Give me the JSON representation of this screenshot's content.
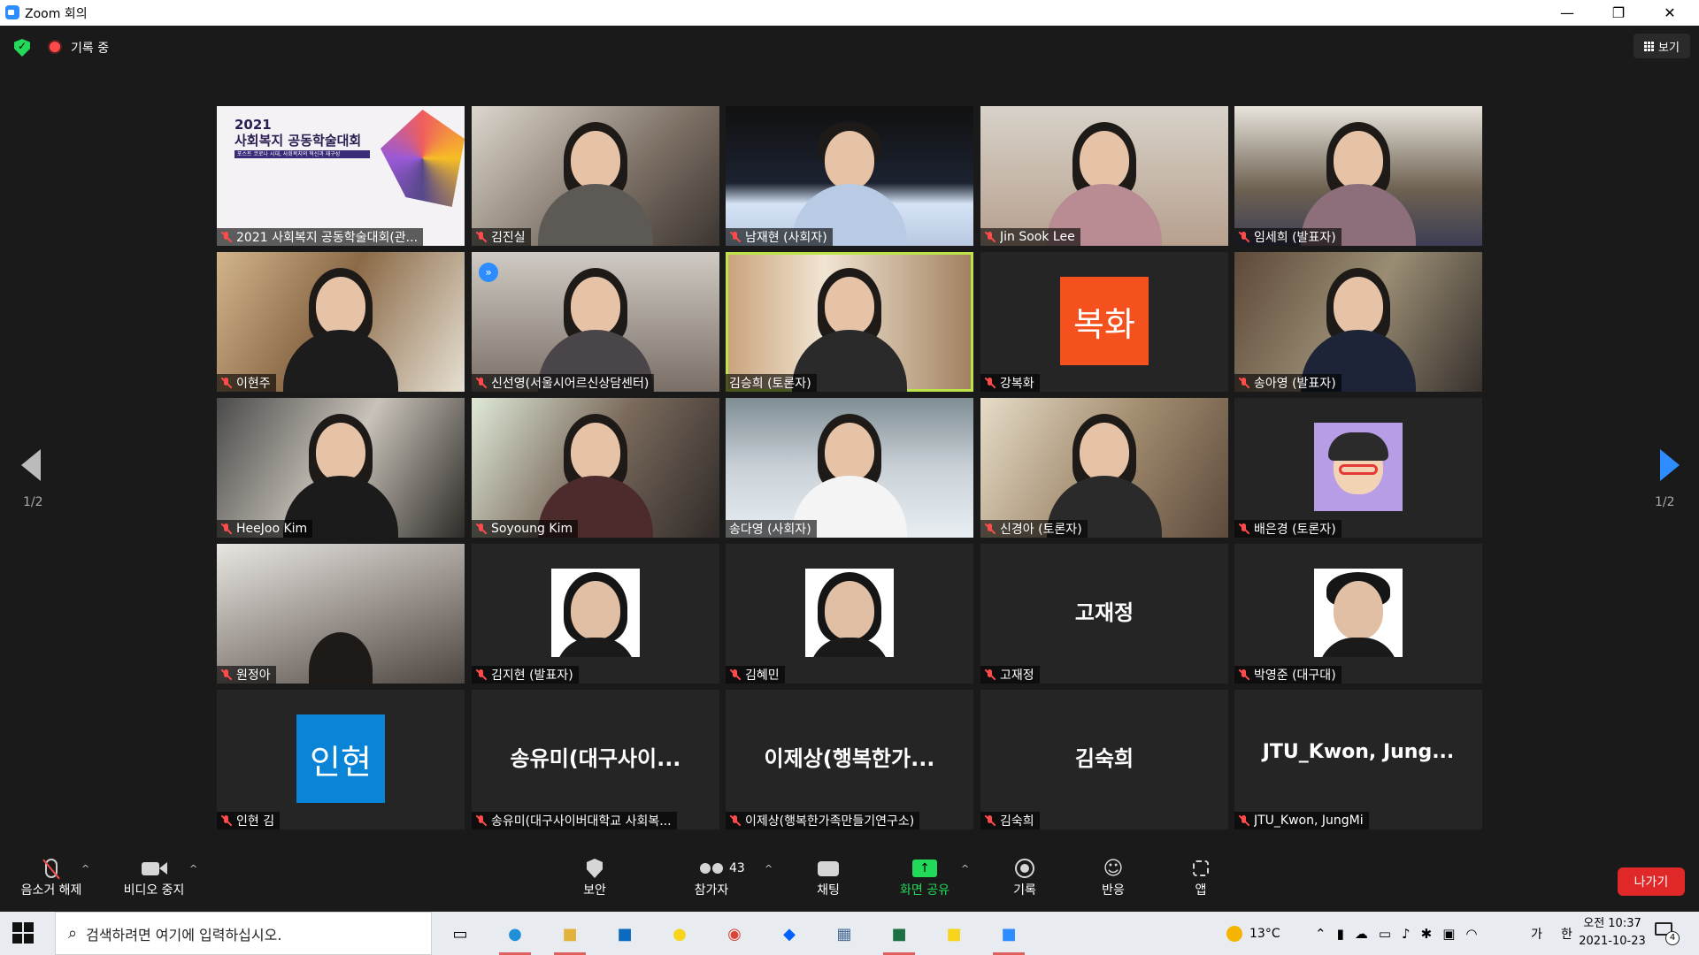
{
  "window": {
    "title": "Zoom 회의",
    "minimize": "—",
    "restore": "❐",
    "close": "✕"
  },
  "status": {
    "recording_label": "기록 중",
    "view_label": "보기"
  },
  "pager": {
    "left": "1/2",
    "right": "1/2"
  },
  "tiles": [
    {
      "name": "2021 사회복지 공동학술대회(관...",
      "muted": true
    },
    {
      "name": "김진실",
      "muted": true
    },
    {
      "name": "남재현 (사회자)",
      "muted": true
    },
    {
      "name": "Jin Sook Lee",
      "muted": true
    },
    {
      "name": "임세희 (발표자)",
      "muted": true
    },
    {
      "name": "이현주",
      "muted": true
    },
    {
      "name": "신선영(서울시어르신상담센터)",
      "muted": true
    },
    {
      "name": "김승희 (토론자)",
      "muted": false
    },
    {
      "name": "강복화",
      "muted": true,
      "avatar_text": "복화",
      "avatar_color": "#f4511e"
    },
    {
      "name": "송아영 (발표자)",
      "muted": true
    },
    {
      "name": "HeeJoo Kim",
      "muted": true
    },
    {
      "name": "Soyoung Kim",
      "muted": true
    },
    {
      "name": "송다영 (사회자)",
      "muted": false
    },
    {
      "name": "신경아 (토론자)",
      "muted": true
    },
    {
      "name": "배은경 (토론자)",
      "muted": true
    },
    {
      "name": "원정아",
      "muted": true
    },
    {
      "name": "김지현 (발표자)",
      "muted": true
    },
    {
      "name": "김혜민",
      "muted": true
    },
    {
      "name": "고재정",
      "muted": true,
      "center_name": "고재정"
    },
    {
      "name": "박영준 (대구대)",
      "muted": true
    },
    {
      "name": "인현 김",
      "muted": true,
      "avatar_text": "인현",
      "avatar_color": "#0a84d6"
    },
    {
      "name": "송유미(대구사이버대학교 사회복...",
      "muted": true,
      "center_name": "송유미(대구사이..."
    },
    {
      "name": "이제상(행복한가족만들기연구소)",
      "muted": true,
      "center_name": "이제상(행복한가..."
    },
    {
      "name": "김숙희",
      "muted": true,
      "center_name": "김숙희"
    },
    {
      "name": "JTU_Kwon, JungMi",
      "muted": true,
      "center_name": "JTU_Kwon, Jung..."
    }
  ],
  "slide": {
    "title_line1": "2021",
    "title_line2": "사회복지 공동학술대회",
    "subtitle": "포스트 코로나 시대, 사회복지의 혁신과 재구성"
  },
  "toolbar": {
    "unmute": "음소거 해제",
    "stop_video": "비디오 중지",
    "security": "보안",
    "participants": "참가자",
    "participants_count": "43",
    "chat": "채팅",
    "share_screen": "화면 공유",
    "record": "기록",
    "reactions": "반응",
    "apps": "앱",
    "leave": "나가기",
    "share_color": "#23d959"
  },
  "taskbar": {
    "search_placeholder": "검색하려면 여기에 입력하십시오.",
    "weather": "13°C",
    "ime_lang": "가",
    "ime_mode": "한",
    "time": "오전 10:37",
    "date": "2021-10-23",
    "notification_count": "4"
  }
}
